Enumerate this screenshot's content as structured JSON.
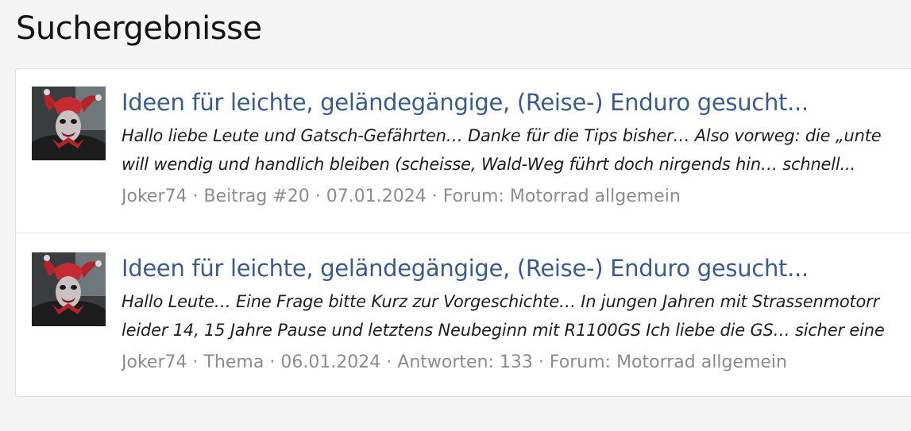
{
  "page_title": "Suchergebnisse",
  "colors": {
    "title_link": "#3c5b8a",
    "meta_text": "#8c8c8c",
    "background": "#f5f5f5",
    "card": "#ffffff"
  },
  "results": [
    {
      "avatar_icon": "jester-avatar",
      "title": "Ideen für leichte, geländegängige, (Reise-) Enduro gesucht...",
      "snippet_line1": "Hallo liebe Leute und Gatsch-Gefährten… Danke für die Tips bisher… Also vorweg: die „unte",
      "snippet_line2": "will wendig und handlich bleiben (scheisse, Wald-Weg führt doch nirgends hin… schnell...",
      "author": "Joker74",
      "type": "Beitrag #20",
      "date": "07.01.2024",
      "forum": "Forum: Motorrad allgemein"
    },
    {
      "avatar_icon": "jester-avatar",
      "title": "Ideen für leichte, geländegängige, (Reise-) Enduro gesucht...",
      "snippet_line1": "Hallo Leute… Eine Frage bitte Kurz zur Vorgeschichte… In jungen Jahren mit Strassenmotorr",
      "snippet_line2": "leider 14, 15 Jahre Pause und letztens Neubeginn mit R1100GS Ich liebe die GS… sicher eine",
      "author": "Joker74",
      "type": "Thema",
      "date": "06.01.2024",
      "replies": "Antworten: 133",
      "forum": "Forum: Motorrad allgemein"
    }
  ]
}
